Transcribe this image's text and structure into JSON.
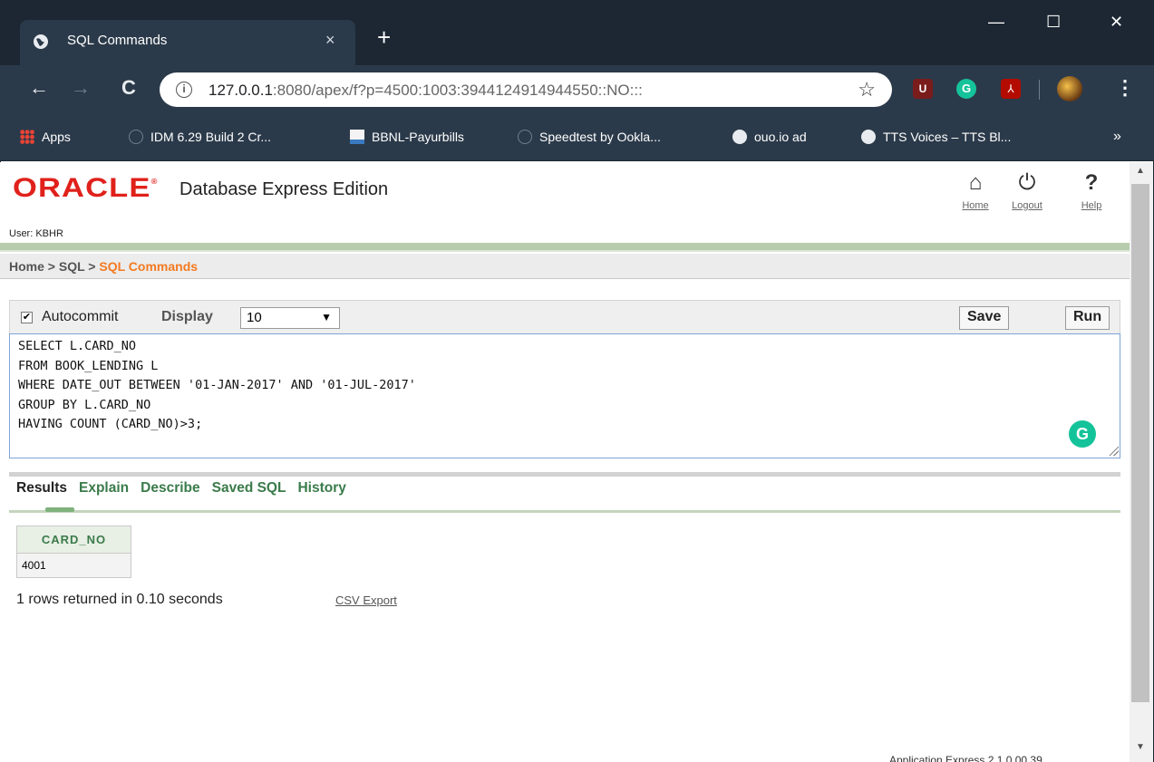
{
  "browser": {
    "tab_title": "SQL Commands",
    "tab_close": "×",
    "new_tab": "+",
    "window": {
      "minimize": "—",
      "maximize": "☐",
      "close": "✕"
    },
    "nav": {
      "back": "←",
      "forward": "→",
      "reload": "C"
    },
    "url_host": "127.0.0.1",
    "url_rest": ":8080/apex/f?p=4500:1003:3944124914944550::NO:::",
    "star": "☆",
    "extensions": {
      "ublock": "U",
      "grammarly": "G",
      "pdf": "⅄"
    },
    "menu": "⋮",
    "bookmarks": [
      "Apps",
      "IDM 6.29 Build 2 Cr...",
      "BBNL-Payurbills",
      "Speedtest by Ookla...",
      "ouo.io ad",
      "TTS Voices – TTS Bl..."
    ],
    "bookmarks_more": "»"
  },
  "header": {
    "logo": "ORACLE",
    "logo_mark": "®",
    "product": "Database Express Edition",
    "icons": [
      {
        "label": "Home",
        "glyph": "⌂"
      },
      {
        "label": "Logout",
        "glyph": "⏻"
      },
      {
        "label": "Help",
        "glyph": "?"
      }
    ],
    "user": "User: KBHR"
  },
  "breadcrumb": {
    "home": "Home",
    "sep1": " > ",
    "sql": "SQL",
    "sep2": " > ",
    "current": "SQL Commands"
  },
  "command_bar": {
    "autocommit_label": "Autocommit",
    "autocommit_checked": true,
    "display_label": "Display",
    "display_value": "10",
    "save_label": "Save",
    "run_label": "Run"
  },
  "editor": {
    "lines": [
      "SELECT L.CARD_NO",
      "FROM BOOK_LENDING L",
      "WHERE DATE_OUT BETWEEN '01-JAN-2017' AND '01-JUL-2017'",
      "GROUP BY L.CARD_NO",
      "HAVING COUNT (CARD_NO)>3;"
    ]
  },
  "result_tabs": [
    "Results",
    "Explain",
    "Describe",
    "Saved SQL",
    "History"
  ],
  "results": {
    "column": "CARD_NO",
    "rows": [
      "4001"
    ],
    "summary": "1 rows returned in 0.10 seconds",
    "csv_export": "CSV Export"
  },
  "footer": "Application Express 2.1.0.00.39",
  "colors": {
    "oracle_red": "#e0211b",
    "accent_orange": "#f47a20",
    "tab_green": "#3a7b4a",
    "chrome_dark": "#2b3a4a"
  }
}
